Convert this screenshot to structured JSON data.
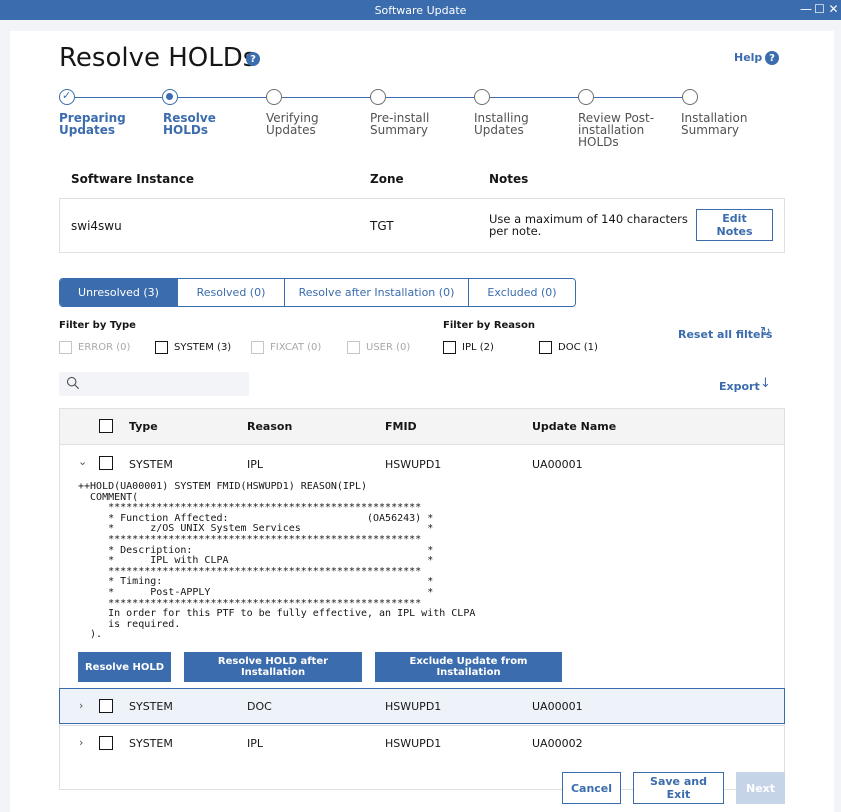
{
  "window": {
    "title": "Software Update",
    "controls": {
      "minimize": "—",
      "maximize": "☐",
      "close": "✕"
    }
  },
  "header": {
    "title": "Resolve HOLDs",
    "help_label": "Help"
  },
  "steps": [
    {
      "label": "Preparing Updates",
      "state": "done"
    },
    {
      "label": "Resolve HOLDs",
      "state": "current"
    },
    {
      "label": "Verifying Updates",
      "state": "pending"
    },
    {
      "label": "Pre-install Summary",
      "state": "pending"
    },
    {
      "label": "Installing Updates",
      "state": "pending"
    },
    {
      "label": "Review Post-installation HOLDs",
      "state": "pending"
    },
    {
      "label": "Installation Summary",
      "state": "pending"
    }
  ],
  "instance": {
    "headers": {
      "instance": "Software Instance",
      "zone": "Zone",
      "notes": "Notes"
    },
    "name": "swi4swu",
    "zone": "TGT",
    "notes": "Use a maximum of 140 characters per note.",
    "edit_notes_label": "Edit Notes"
  },
  "tabs": [
    {
      "label": "Unresolved (3)",
      "active": true
    },
    {
      "label": "Resolved (0)",
      "active": false
    },
    {
      "label": "Resolve after Installation (0)",
      "active": false
    },
    {
      "label": "Excluded (0)",
      "active": false
    }
  ],
  "filters": {
    "type_title": "Filter by Type",
    "reason_title": "Filter by Reason",
    "type_options": [
      {
        "label": "ERROR (0)",
        "disabled": true
      },
      {
        "label": "SYSTEM (3)",
        "disabled": false
      },
      {
        "label": "FIXCAT (0)",
        "disabled": true
      },
      {
        "label": "USER (0)",
        "disabled": true
      }
    ],
    "reason_options": [
      {
        "label": "IPL (2)",
        "disabled": false
      },
      {
        "label": "DOC (1)",
        "disabled": false
      }
    ],
    "reset_label": "Reset all filters"
  },
  "search": {
    "placeholder": ""
  },
  "export_label": "Export",
  "table": {
    "headers": {
      "type": "Type",
      "reason": "Reason",
      "fmid": "FMID",
      "update": "Update Name"
    },
    "rows": [
      {
        "type": "SYSTEM",
        "reason": "IPL",
        "fmid": "HSWUPD1",
        "update": "UA00001",
        "expanded": true
      },
      {
        "type": "SYSTEM",
        "reason": "DOC",
        "fmid": "HSWUPD1",
        "update": "UA00001",
        "expanded": false
      },
      {
        "type": "SYSTEM",
        "reason": "IPL",
        "fmid": "HSWUPD1",
        "update": "UA00002",
        "expanded": false
      }
    ],
    "hold_text": "++HOLD(UA00001) SYSTEM FMID(HSWUPD1) REASON(IPL)\n  COMMENT(\n     ****************************************************\n     * Function Affected:                       (OA56243) *\n     *      z/OS UNIX System Services                     *\n     ****************************************************\n     * Description:                                       *\n     *      IPL with CLPA                                 *\n     ****************************************************\n     * Timing:                                            *\n     *      Post-APPLY                                    *\n     ****************************************************\n     In order for this PTF to be fully effective, an IPL with CLPA\n     is required.\n  ).",
    "actions": {
      "resolve": "Resolve HOLD",
      "resolve_after": "Resolve HOLD after Installation",
      "exclude": "Exclude Update from Installation"
    }
  },
  "footer": {
    "cancel": "Cancel",
    "save_exit": "Save and Exit",
    "next": "Next"
  }
}
